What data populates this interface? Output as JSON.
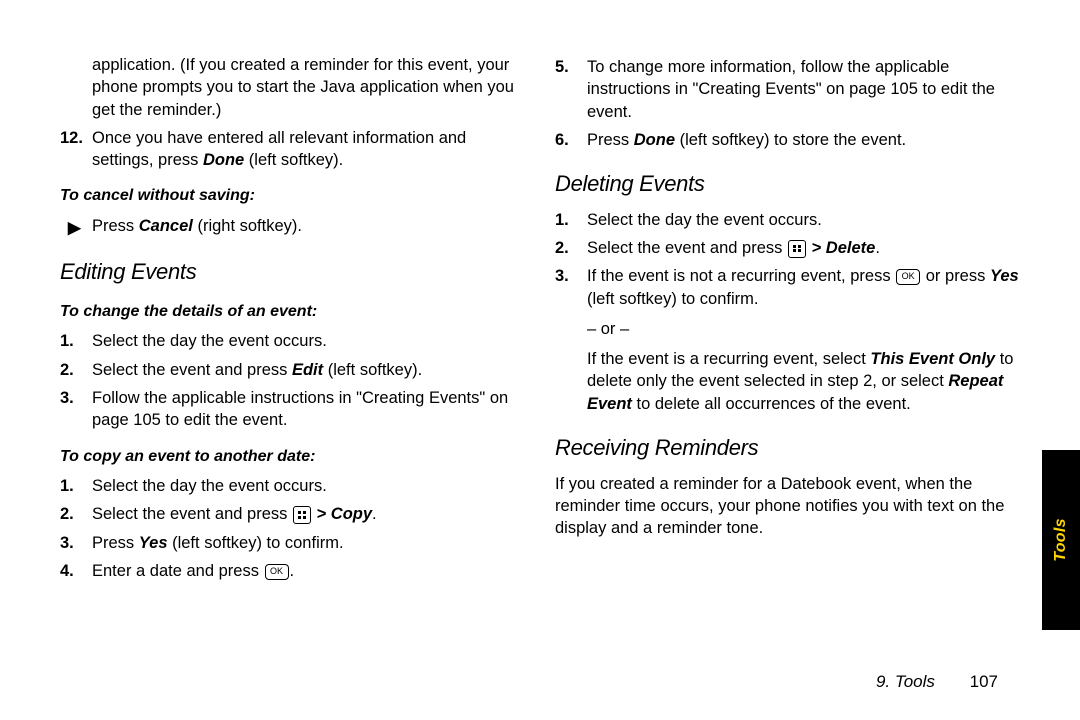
{
  "left": {
    "intro_continued": "application. (If you created a reminder for this event, your phone prompts you to start the Java application when you get the reminder.)",
    "step12_a": "Once you have entered all relevant information and settings, press ",
    "step12_done": "Done",
    "step12_b": " (left softkey).",
    "cancel_sub": "To cancel without saving:",
    "cancel_a": "Press ",
    "cancel_word": "Cancel",
    "cancel_b": " (right softkey).",
    "editing_head": "Editing Events",
    "change_sub": "To change the details of an event:",
    "edit_s1": "Select the day the event occurs.",
    "edit_s2_a": "Select the event and press ",
    "edit_s2_word": "Edit",
    "edit_s2_b": " (left softkey).",
    "edit_s3": "Follow the applicable instructions in \"Creating Events\" on page 105 to edit the event.",
    "copy_sub": "To copy an event to another date:",
    "copy_s1": "Select the day the event occurs.",
    "copy_s2_a": "Select the event and press ",
    "copy_s2_gt": " > ",
    "copy_s2_word": "Copy",
    "copy_s2_dot": ".",
    "copy_s3_a": "Press ",
    "copy_s3_word": "Yes",
    "copy_s3_b": " (left softkey) to confirm.",
    "copy_s4_a": "Enter a date and press ",
    "copy_s4_ok": "OK",
    "copy_s4_dot": "."
  },
  "right": {
    "s5": "To change more information, follow the applicable instructions in \"Creating Events\" on page 105 to edit the event.",
    "s6_a": "Press ",
    "s6_word": "Done",
    "s6_b": " (left softkey) to store the event.",
    "del_head": "Deleting Events",
    "del_s1": "Select the day the event occurs.",
    "del_s2_a": "Select the event and press ",
    "del_s2_gt": " > ",
    "del_s2_word": "Delete",
    "del_s2_dot": ".",
    "del_s3_a": "If the event is not a recurring event, press ",
    "del_s3_ok": "OK",
    "del_s3_b": " or press ",
    "del_s3_yes": "Yes",
    "del_s3_c": " (left softkey) to confirm.",
    "or_text": "– or –",
    "del_s3_d": "If the event is a recurring event, select ",
    "del_s3_thisevent": "This Event Only",
    "del_s3_e": " to delete only the event selected in step 2, or select ",
    "del_s3_repeat": "Repeat Event",
    "del_s3_f": " to delete all occurrences of the event.",
    "recv_head": "Receiving Reminders",
    "recv_body": "If you created a reminder for a Datebook event, when the reminder time occurs, your phone notifies you with text on the display and a reminder tone."
  },
  "footer": {
    "chapter": "9. Tools",
    "page": "107"
  },
  "tab": {
    "label": "Tools"
  },
  "numbers": {
    "n12": "12.",
    "n1": "1.",
    "n2": "2.",
    "n3": "3.",
    "n4": "4.",
    "n5": "5.",
    "n6": "6."
  }
}
